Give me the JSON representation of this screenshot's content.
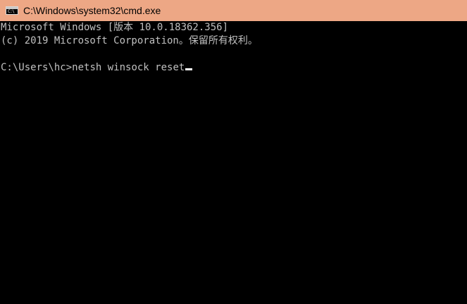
{
  "window": {
    "title": "C:\\Windows\\system32\\cmd.exe",
    "icon": "console-app-icon",
    "icon_glyph": "C:\\",
    "titlebar_color": "#eda785"
  },
  "console": {
    "lines": [
      "Microsoft Windows [版本 10.0.18362.356]",
      "(c) 2019 Microsoft Corporation。保留所有权利。",
      ""
    ],
    "prompt": "C:\\Users\\hc>",
    "command": "netsh winsock reset"
  }
}
